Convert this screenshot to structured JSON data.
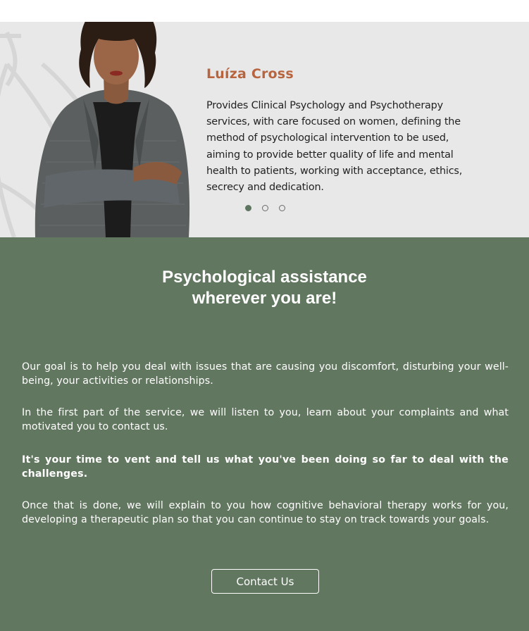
{
  "profile": {
    "name": "Luíza Cross",
    "bio": "Provides Clinical Psychology and Psychotherapy services, with care focused on women, defining the method of psychological intervention to be used, aiming to provide better quality of life and mental health to patients, working with acceptance, ethics, secrecy and dedication.",
    "carousel": {
      "total": 3,
      "active_index": 0
    }
  },
  "section": {
    "headline_line1": "Psychological assistance",
    "headline_line2": "wherever you are!",
    "paragraph1": "Our goal is to help you deal with issues that are causing you discomfort, disturbing your well-being, your activities or relationships.",
    "paragraph2": "In the first part of the service, we will listen to you, learn about your complaints and what motivated you to contact us.",
    "paragraph3": "It's your time to vent and tell us what you've been doing so far to deal with the challenges.",
    "paragraph4": "Once that is done, we will explain to you how cognitive behavioral therapy works for you, developing a therapeutic plan so that you can continue to stay on track towards your goals.",
    "contact_label": "Contact Us"
  },
  "colors": {
    "accent_name": "#b8653f",
    "section_bg": "#627760",
    "hero_bg": "#e8e8e8",
    "dot_active": "#5e7560"
  }
}
